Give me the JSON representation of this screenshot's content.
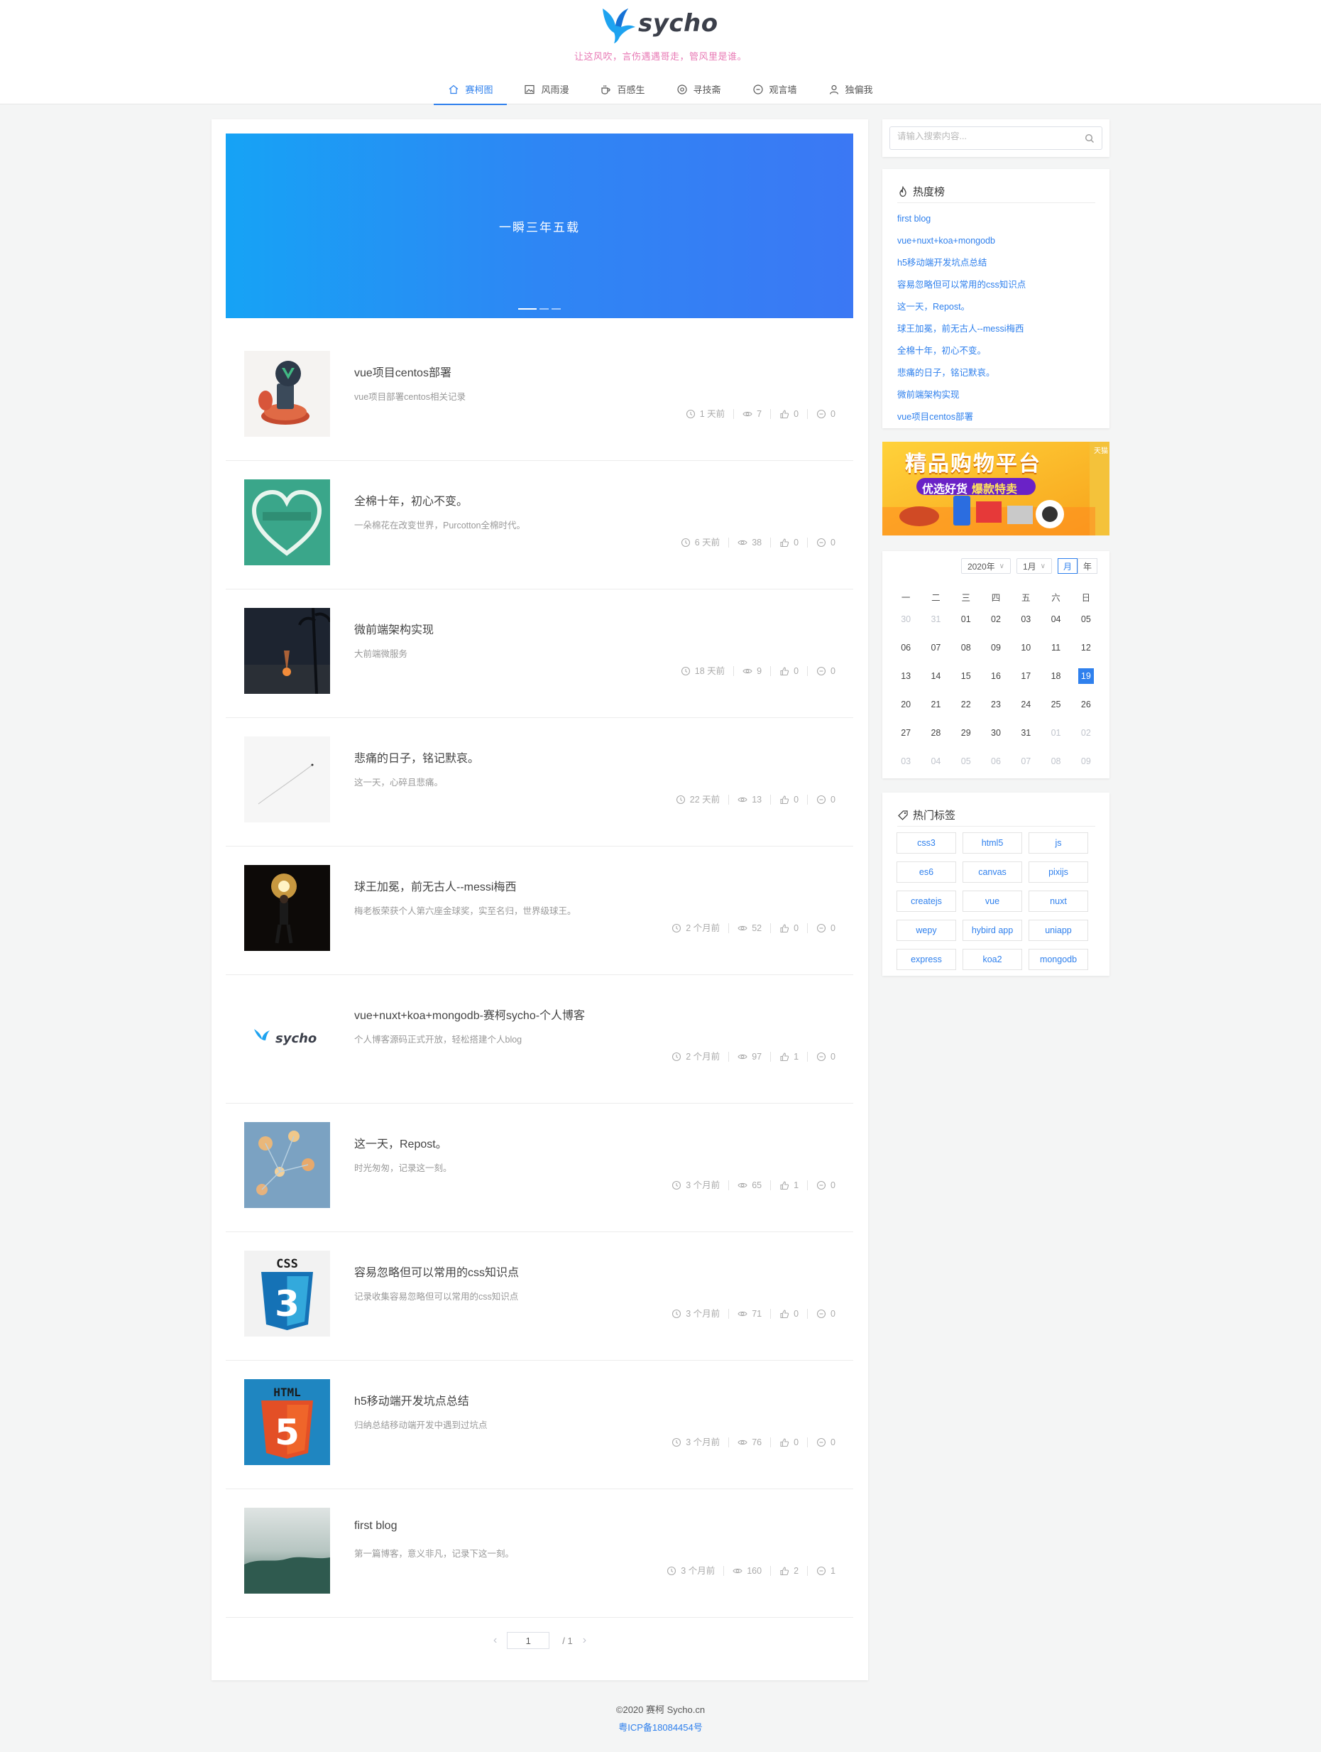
{
  "site": {
    "logo_text": "sycho",
    "slogan": "让这风吹，言伤遇遇哥走，管风里是谁。",
    "brand_color": "#2f80ed",
    "slogan_color": "#e87ab5"
  },
  "nav": [
    {
      "label": "赛柯图",
      "icon": "home-icon",
      "active": true
    },
    {
      "label": "风雨漫",
      "icon": "image-icon",
      "active": false
    },
    {
      "label": "百感生",
      "icon": "coffee-icon",
      "active": false
    },
    {
      "label": "寻技斋",
      "icon": "compass-icon",
      "active": false
    },
    {
      "label": "观言墙",
      "icon": "chat-icon",
      "active": false
    },
    {
      "label": "独偏我",
      "icon": "user-icon",
      "active": false
    }
  ],
  "banner": {
    "text": "一瞬三年五载",
    "slides": 3,
    "active": 0
  },
  "articles": [
    {
      "title": "vue项目centos部署",
      "desc": "vue项目部署centos相关记录",
      "time": "1 天前",
      "views": "7",
      "likes": "0",
      "comments": "0",
      "thumb": "vue-3d"
    },
    {
      "title": "全棉十年，初心不变。",
      "desc": "一朵棉花在改变世界，Purcotton全棉时代。",
      "time": "6 天前",
      "views": "38",
      "likes": "0",
      "comments": "0",
      "thumb": "heart-sign"
    },
    {
      "title": "微前端架构实现",
      "desc": "大前端微服务",
      "time": "18 天前",
      "views": "9",
      "likes": "0",
      "comments": "0",
      "thumb": "night-fire"
    },
    {
      "title": "悲痛的日子，铭记默哀。",
      "desc": "这一天，心碎且悲痛。",
      "time": "22 天前",
      "views": "13",
      "likes": "0",
      "comments": "0",
      "thumb": "white-line"
    },
    {
      "title": "球王加冕，前无古人--messi梅西",
      "desc": "梅老板荣获个人第六座金球奖，实至名归，世界级球王。",
      "time": "2 个月前",
      "views": "52",
      "likes": "0",
      "comments": "0",
      "thumb": "messi"
    },
    {
      "title": "vue+nuxt+koa+mongodb-赛柯sycho-个人博客",
      "desc": "个人博客源码正式开放，轻松搭建个人blog",
      "time": "2 个月前",
      "views": "97",
      "likes": "1",
      "comments": "0",
      "thumb": "sycho-logo",
      "thumb_text": "sycho"
    },
    {
      "title": "这一天，Repost。",
      "desc": "时光匆匆，记录这一刻。",
      "time": "3 个月前",
      "views": "65",
      "likes": "1",
      "comments": "0",
      "thumb": "flowers"
    },
    {
      "title": "容易忽略但可以常用的css知识点",
      "desc": "记录收集容易忽略但可以常用的css知识点",
      "time": "3 个月前",
      "views": "71",
      "likes": "0",
      "comments": "0",
      "thumb": "css3",
      "thumb_text": "CSS"
    },
    {
      "title": "h5移动端开发坑点总结",
      "desc": "归纳总结移动端开发中遇到过坑点",
      "time": "3 个月前",
      "views": "76",
      "likes": "0",
      "comments": "0",
      "thumb": "html5",
      "thumb_text": "HTML"
    },
    {
      "title": "first blog",
      "desc": "第一篇博客，意义非凡，记录下这一刻。",
      "time": "3 个月前",
      "views": "160",
      "likes": "2",
      "comments": "1",
      "thumb": "forest-fog"
    }
  ],
  "pager": {
    "current": "1",
    "total": "/ 1",
    "prev": "‹",
    "next": "›"
  },
  "search": {
    "placeholder": "请输入搜索内容..."
  },
  "hot": {
    "title": "热度榜",
    "items": [
      "first blog",
      "vue+nuxt+koa+mongodb",
      "h5移动端开发坑点总结",
      "容易忽略但可以常用的css知识点",
      "这一天，Repost。",
      "球王加冕，前无古人--messi梅西",
      "全棉十年，初心不变。",
      "悲痛的日子，铭记默哀。",
      "微前端架构实现",
      "vue项目centos部署"
    ]
  },
  "ad": {
    "title": "精品购物平台",
    "subtitle": "优选好货",
    "highlight": "爆款特卖",
    "corner": "天猫"
  },
  "calendar": {
    "year": "2020年",
    "month": "1月",
    "mode_month": "月",
    "mode_year": "年",
    "weekdays": [
      "一",
      "二",
      "三",
      "四",
      "五",
      "六",
      "日"
    ],
    "days": [
      {
        "d": "30",
        "dim": true
      },
      {
        "d": "31",
        "dim": true
      },
      {
        "d": "01"
      },
      {
        "d": "02"
      },
      {
        "d": "03"
      },
      {
        "d": "04"
      },
      {
        "d": "05"
      },
      {
        "d": "06"
      },
      {
        "d": "07"
      },
      {
        "d": "08"
      },
      {
        "d": "09"
      },
      {
        "d": "10"
      },
      {
        "d": "11"
      },
      {
        "d": "12"
      },
      {
        "d": "13"
      },
      {
        "d": "14"
      },
      {
        "d": "15"
      },
      {
        "d": "16"
      },
      {
        "d": "17"
      },
      {
        "d": "18"
      },
      {
        "d": "19",
        "today": true
      },
      {
        "d": "20"
      },
      {
        "d": "21"
      },
      {
        "d": "22"
      },
      {
        "d": "23"
      },
      {
        "d": "24"
      },
      {
        "d": "25"
      },
      {
        "d": "26"
      },
      {
        "d": "27"
      },
      {
        "d": "28"
      },
      {
        "d": "29"
      },
      {
        "d": "30"
      },
      {
        "d": "31"
      },
      {
        "d": "01",
        "dim": true
      },
      {
        "d": "02",
        "dim": true
      },
      {
        "d": "03",
        "dim": true
      },
      {
        "d": "04",
        "dim": true
      },
      {
        "d": "05",
        "dim": true
      },
      {
        "d": "06",
        "dim": true
      },
      {
        "d": "07",
        "dim": true
      },
      {
        "d": "08",
        "dim": true
      },
      {
        "d": "09",
        "dim": true
      }
    ]
  },
  "tags": {
    "title": "热门标签",
    "items": [
      "css3",
      "html5",
      "js",
      "es6",
      "canvas",
      "pixijs",
      "createjs",
      "vue",
      "nuxt",
      "wepy",
      "hybird app",
      "uniapp",
      "express",
      "koa2",
      "mongodb"
    ]
  },
  "footer": {
    "copyright": "©2020 赛柯 Sycho.cn",
    "icp": "粤ICP备18084454号"
  }
}
